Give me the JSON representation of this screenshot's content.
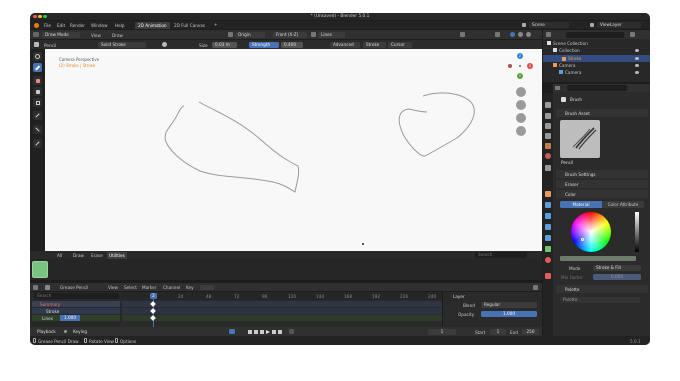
{
  "title_bar": {
    "title": "* (Unsaved) - Blender 5.0.1"
  },
  "menu": {
    "items": [
      "File",
      "Edit",
      "Render",
      "Window",
      "Help"
    ],
    "workspaces": [
      "2D Animation",
      "2D Full Canvas"
    ],
    "add_tab": "+",
    "scene": "Scene",
    "view_layer": "ViewLayer"
  },
  "viewport_header": {
    "mode": "Draw Mode",
    "view": "View",
    "draw": "Draw",
    "origin": "Origin",
    "front": "Front (X-Z)",
    "lines": "Lines"
  },
  "tool_settings": {
    "brush": "Pencil",
    "stroke_mode": "Solid Stroke",
    "size_label": "Size",
    "size_value": "0.03 m",
    "strength_label": "Strength",
    "strength_value": "0.400",
    "advanced": "Advanced",
    "stroke": "Stroke",
    "cursor": "Cursor"
  },
  "viewport": {
    "camera_label": "Camera Perspective",
    "object_label": "(2) Stroke | Stroke",
    "gizmo": {
      "z": "Z",
      "x": "X",
      "y": "Y"
    }
  },
  "asset_shelf": {
    "tabs": [
      "All",
      "Draw",
      "Erase",
      "Utilities"
    ],
    "active_tab": "Utilities",
    "search_placeholder": "Search"
  },
  "timeline": {
    "editor": "Grease Pencil",
    "menus": [
      "View",
      "Select",
      "Marker",
      "Channel",
      "Key"
    ],
    "search_placeholder": "Search",
    "channels": [
      {
        "name": "Summary"
      },
      {
        "name": "Stroke"
      },
      {
        "name": "Lines",
        "value": "1.000"
      }
    ],
    "current_frame": "2",
    "ticks": [
      "2",
      "24",
      "48",
      "72",
      "96",
      "120",
      "144",
      "168",
      "192",
      "216",
      "240"
    ],
    "footer": {
      "playback": "Playback",
      "keying": "Keying",
      "frame": "1",
      "start_label": "Start",
      "start": "1",
      "end_label": "End",
      "end": "250"
    }
  },
  "layer_panel": {
    "title": "Layer",
    "blend_label": "Blend",
    "blend_value": "Regular",
    "opacity_label": "Opacity",
    "opacity_value": "1.000"
  },
  "outliner": {
    "search_placeholder": "",
    "items": [
      {
        "name": "Scene Collection",
        "level": 0
      },
      {
        "name": "Collection",
        "level": 1
      },
      {
        "name": "Stroke",
        "level": 2
      },
      {
        "name": "Camera",
        "level": 1
      },
      {
        "name": "Camera",
        "level": 2
      }
    ]
  },
  "properties": {
    "brush_name": "Brush",
    "brush_asset_title": "Brush Asset",
    "brush_asset_name": "Pencil",
    "brush_settings": "Brush Settings",
    "eraser": "Eraser",
    "color": "Color",
    "color_tabs": [
      "Material",
      "Color Attribute"
    ],
    "active_color_tab": "Material",
    "mode_label": "Mode",
    "mode_value": "Stroke & Fill",
    "mix_factor_label": "Mix Factor",
    "mix_factor_value": "0.000",
    "palette": "Palette",
    "palette_field": "Palette"
  },
  "status_bar": {
    "items": [
      "Grease Pencil Draw",
      "Rotate View",
      "Options"
    ],
    "version": "5.0.1"
  },
  "colors": {
    "accent": "#4772b3",
    "header": "#303030",
    "viewport": "#f8f8f8",
    "stroke": "#9a9a9a",
    "active_frame": "#4772b3"
  }
}
